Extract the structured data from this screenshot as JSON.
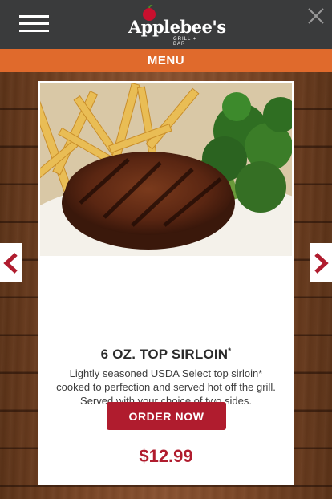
{
  "header": {
    "logo_text": "Applebee's",
    "logo_subtext": "GRILL + BAR",
    "menu_icon": "hamburger-menu-icon",
    "close_icon": "close-icon"
  },
  "menubar": {
    "label": "MENU"
  },
  "carousel": {
    "prev_icon": "chevron-left-icon",
    "next_icon": "chevron-right-icon"
  },
  "item": {
    "title": "6 OZ. TOP SIRLOIN",
    "title_mark": "*",
    "description": "Lightly seasoned USDA Select top sirloin* cooked to perfection and served hot off the grill. Served with your choice of two sides.",
    "price": "$12.99",
    "order_label": "ORDER NOW"
  },
  "colors": {
    "header_bg": "#3a3b3c",
    "menubar_bg": "#e06a2c",
    "brand_red": "#b01c2e"
  }
}
